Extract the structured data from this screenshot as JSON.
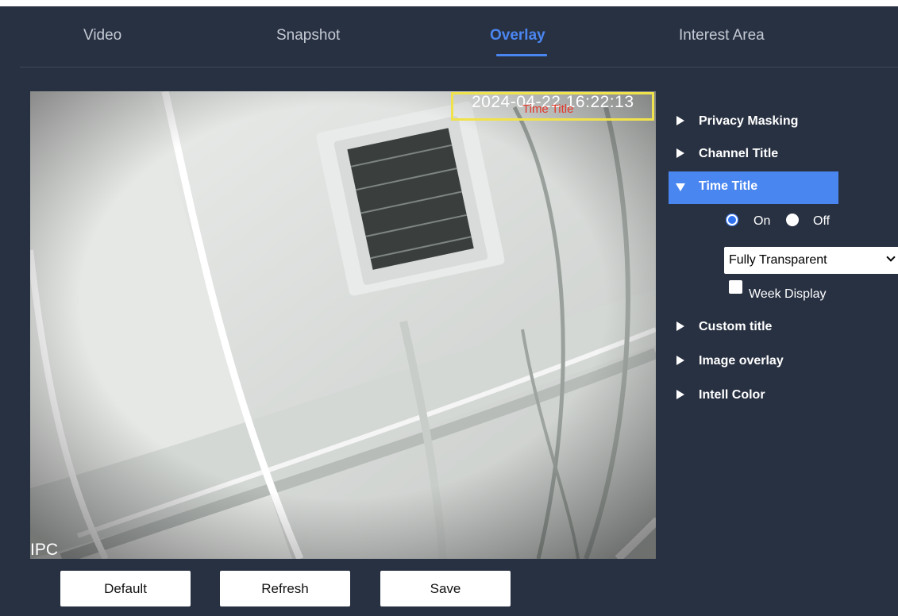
{
  "tabs": [
    {
      "label": "Video",
      "active": false
    },
    {
      "label": "Snapshot",
      "active": false
    },
    {
      "label": "Overlay",
      "active": true
    },
    {
      "label": "Interest Area",
      "active": false
    }
  ],
  "preview": {
    "osd_time": "2024-04-22 16:22:13",
    "osd_time_label": "Time Title",
    "osd_channel": "IPC"
  },
  "menu": {
    "items": [
      {
        "label": "Privacy Masking",
        "expanded": false
      },
      {
        "label": "Channel Title",
        "expanded": false
      },
      {
        "label": "Time Title",
        "expanded": true
      },
      {
        "label": "Custom title",
        "expanded": false
      },
      {
        "label": "Image overlay",
        "expanded": false
      },
      {
        "label": "Intell Color",
        "expanded": false
      }
    ],
    "time_title": {
      "on_label": "On",
      "off_label": "Off",
      "selected": "On",
      "transparency": "Fully Transparent",
      "week_display_label": "Week Display",
      "week_display_checked": false
    }
  },
  "buttons": {
    "default_label": "Default",
    "refresh_label": "Refresh",
    "save_label": "Save"
  },
  "colors": {
    "background": "#283142",
    "accent": "#4a86f0",
    "osd_box": "#f0e24a",
    "osd_label": "#e33b2c"
  }
}
